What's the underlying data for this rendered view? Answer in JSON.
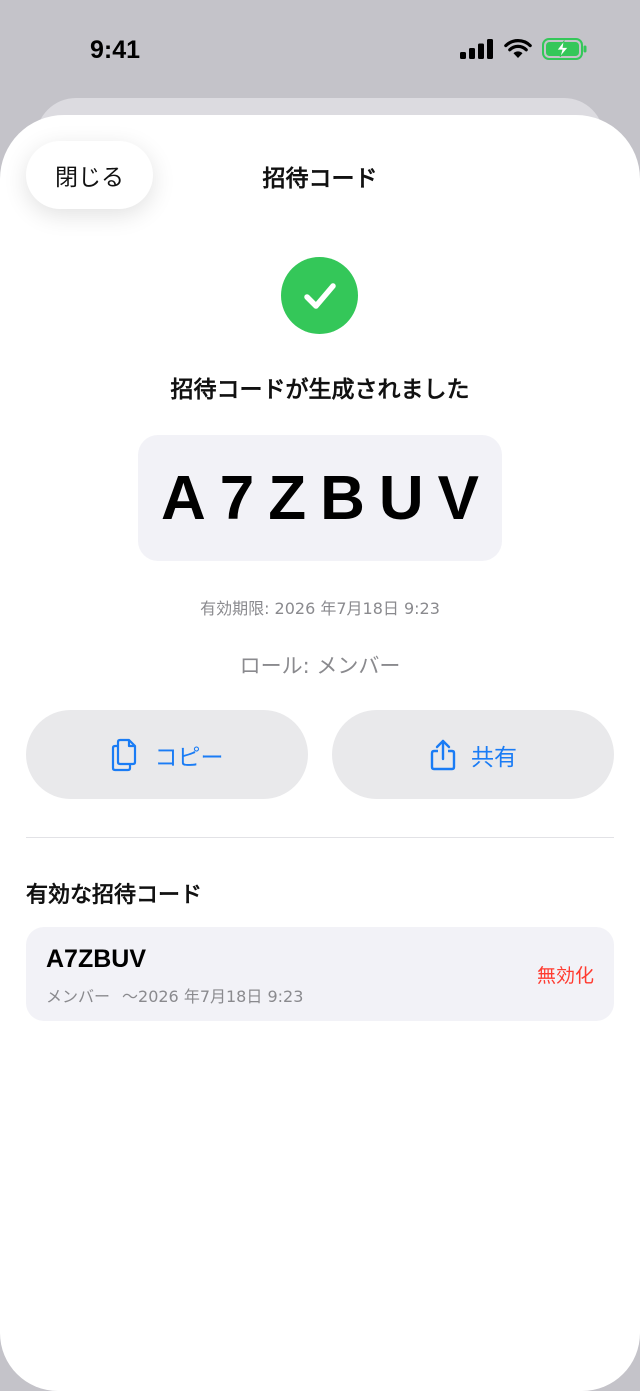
{
  "status_bar": {
    "time": "9:41"
  },
  "nav": {
    "close_label": "閉じる",
    "title": "招待コード"
  },
  "success": {
    "message": "招待コードが生成されました"
  },
  "invite": {
    "code": "A7ZBUV",
    "expiry": "有効期限: 2026 年7月18日 9:23",
    "role": "ロール: メンバー"
  },
  "actions": {
    "copy_label": "コピー",
    "share_label": "共有"
  },
  "active_codes": {
    "title": "有効な招待コード",
    "items": [
      {
        "code": "A7ZBUV",
        "role": "メンバー",
        "expiry": "〜2026 年7月18日 9:23",
        "revoke_label": "無効化"
      }
    ]
  },
  "colors": {
    "accent": "#1a7cf5",
    "success": "#34c759",
    "destructive": "#ff3b30"
  }
}
